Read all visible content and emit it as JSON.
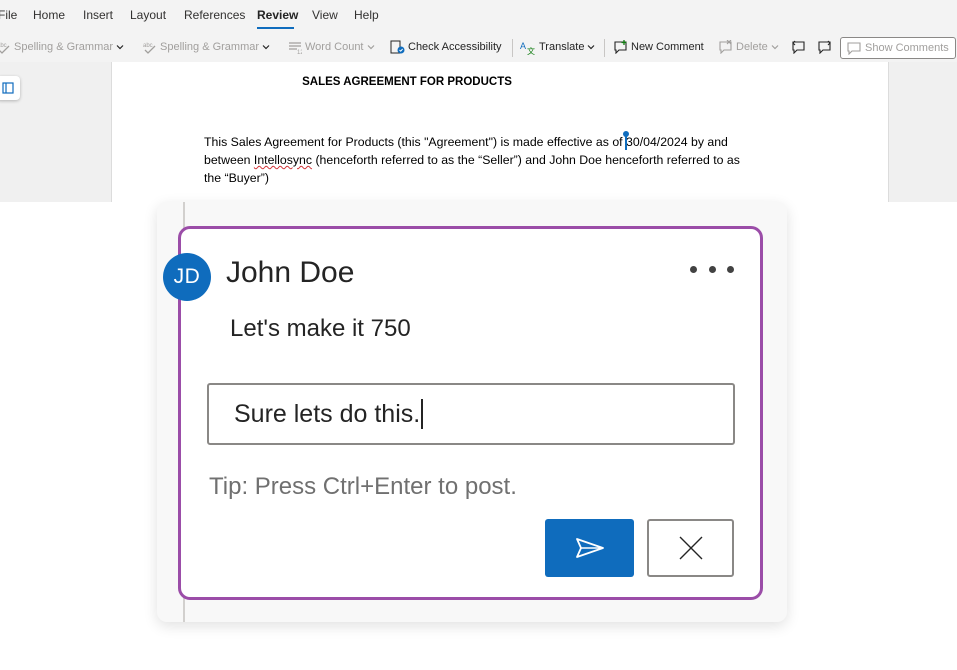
{
  "menu": {
    "items": [
      {
        "label": "File"
      },
      {
        "label": "Home"
      },
      {
        "label": "Insert"
      },
      {
        "label": "Layout"
      },
      {
        "label": "References"
      },
      {
        "label": "Review"
      },
      {
        "label": "View"
      },
      {
        "label": "Help"
      }
    ],
    "active": "Review"
  },
  "toolbar": {
    "spelling_1": "Spelling & Grammar",
    "spelling_2": "Spelling & Grammar",
    "word_count": "Word Count",
    "check_accessibility": "Check Accessibility",
    "translate": "Translate",
    "new_comment": "New Comment",
    "delete": "Delete",
    "show_comments": "Show Comments",
    "icons": [
      "spelling-icon",
      "word-count-icon",
      "accessibility-icon",
      "translate-icon",
      "new-comment-icon",
      "delete-comment-icon",
      "previous-comment-icon",
      "next-comment-icon",
      "comments-pane-icon"
    ]
  },
  "document": {
    "title": "SALES AGREEMENT FOR PRODUCTS",
    "para_part1": "This Sales Agreement for Products (this \"Agreement\") is made effective as of ",
    "para_date": "30/04/2024 by and",
    "para_line2_pre": "between ",
    "para_seller_name": "Intellosync",
    "para_line2_post": " (henceforth referred to as the “Seller”) and John Doe henceforth referred to as",
    "para_line3": "the “Buyer”)"
  },
  "comment": {
    "avatar_initials": "JD",
    "author": "John Doe",
    "text": "Let's make it 750",
    "reply_value": "Sure lets do this.",
    "tip": "Tip: Press Ctrl+Enter to post.",
    "send_icon": "send-icon",
    "cancel_icon": "close-icon"
  },
  "colors": {
    "accent": "#0f6cbd",
    "card_border": "#9b4da8",
    "tip_text": "#707070"
  }
}
